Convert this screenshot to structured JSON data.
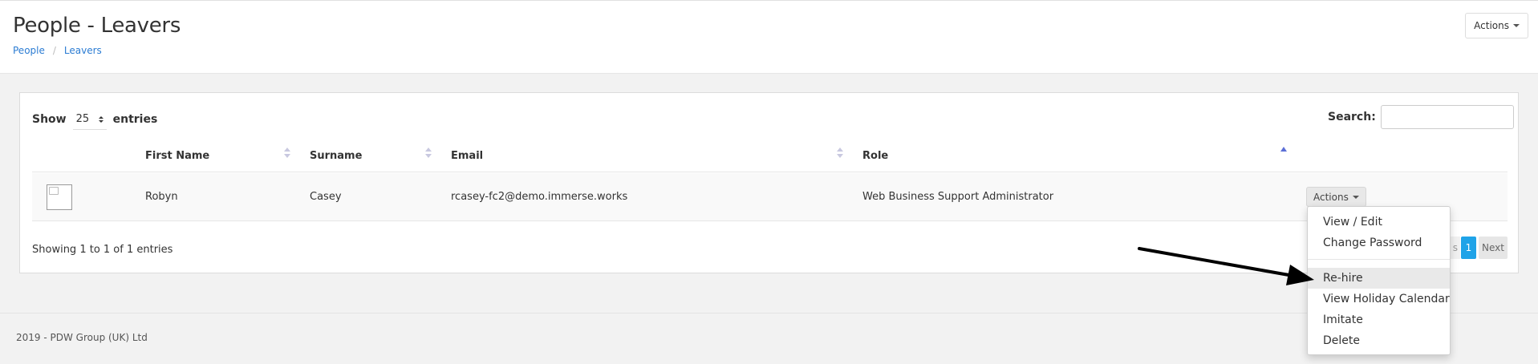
{
  "header": {
    "title": "People - Leavers",
    "breadcrumb": [
      "People",
      "Leavers"
    ],
    "actions_label": "Actions"
  },
  "table_controls": {
    "show_label": "Show",
    "page_length": "25",
    "entries_label": "entries",
    "search_label": "Search:",
    "search_value": ""
  },
  "table": {
    "columns": [
      "First Name",
      "Surname",
      "Email",
      "Role"
    ],
    "rows": [
      {
        "first_name": "Robyn",
        "surname": "Casey",
        "email": "rcasey-fc2@demo.immerse.works",
        "role": "Web Business Support Administrator",
        "actions_label": "Actions"
      }
    ]
  },
  "info": "Showing 1 to 1 of 1 entries",
  "pagination": {
    "previous_partial": "s",
    "current": "1",
    "next": "Next"
  },
  "row_actions_menu": {
    "items": [
      "View / Edit",
      "Change Password",
      "Re-hire",
      "View Holiday Calendar",
      "Imitate",
      "Delete"
    ],
    "highlighted": "Re-hire"
  },
  "footer": "2019 - PDW Group (UK) Ltd",
  "colors": {
    "link": "#2b7cd3",
    "pager_active": "#1fa3e8",
    "sort_active": "#5b6fd6"
  }
}
